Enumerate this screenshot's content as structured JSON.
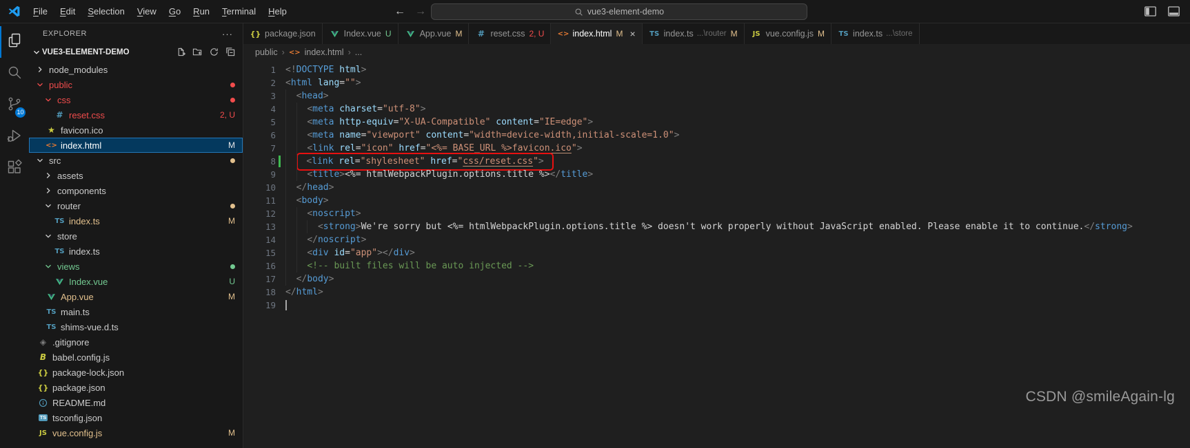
{
  "titlebar": {
    "menus": [
      "File",
      "Edit",
      "Selection",
      "View",
      "Go",
      "Run",
      "Terminal",
      "Help"
    ],
    "back_arrow": "←",
    "forward_arrow": "→",
    "search_value": "vue3-element-demo"
  },
  "activitybar": {
    "items": [
      {
        "name": "explorer",
        "active": true
      },
      {
        "name": "search",
        "active": false
      },
      {
        "name": "source-control",
        "active": false,
        "badge": "10"
      },
      {
        "name": "run-debug",
        "active": false
      },
      {
        "name": "extensions",
        "active": false
      }
    ]
  },
  "sidebar": {
    "header": "EXPLORER",
    "more_actions": "···",
    "project": "VUE3-ELEMENT-DEMO",
    "tree": [
      {
        "label": "node_modules",
        "level": 0,
        "chevron": "right",
        "status": "none"
      },
      {
        "label": "public",
        "level": 0,
        "chevron": "down",
        "status": "error",
        "badge": "dot",
        "badge_status": "error"
      },
      {
        "label": "css",
        "level": 1,
        "chevron": "down",
        "status": "error",
        "badge": "dot",
        "badge_status": "error"
      },
      {
        "label": "reset.css",
        "level": 2,
        "icon": "css",
        "status": "error",
        "badge": "2, U",
        "badge_status": "error"
      },
      {
        "label": "favicon.ico",
        "level": 1,
        "icon": "star",
        "status": "none"
      },
      {
        "label": "index.html",
        "level": 1,
        "icon": "html",
        "status": "selected",
        "selected": true,
        "badge": "M",
        "badge_status": "modified"
      },
      {
        "label": "src",
        "level": 0,
        "chevron": "down",
        "status": "none",
        "badge": "dot",
        "badge_status": "modified"
      },
      {
        "label": "assets",
        "level": 1,
        "chevron": "right",
        "status": "none"
      },
      {
        "label": "components",
        "level": 1,
        "chevron": "right",
        "status": "none"
      },
      {
        "label": "router",
        "level": 1,
        "chevron": "down",
        "status": "none",
        "badge": "dot",
        "badge_status": "modified"
      },
      {
        "label": "index.ts",
        "level": 2,
        "icon": "ts",
        "status": "modified",
        "badge": "M",
        "badge_status": "modified"
      },
      {
        "label": "store",
        "level": 1,
        "chevron": "down",
        "status": "none"
      },
      {
        "label": "index.ts",
        "level": 2,
        "icon": "ts",
        "status": "none"
      },
      {
        "label": "views",
        "level": 1,
        "chevron": "down",
        "status": "untracked",
        "badge": "dot",
        "badge_status": "untracked"
      },
      {
        "label": "Index.vue",
        "level": 2,
        "icon": "vue",
        "status": "untracked",
        "badge": "U",
        "badge_status": "untracked"
      },
      {
        "label": "App.vue",
        "level": 1,
        "icon": "vue",
        "status": "modified",
        "badge": "M",
        "badge_status": "modified"
      },
      {
        "label": "main.ts",
        "level": 1,
        "icon": "ts",
        "status": "none"
      },
      {
        "label": "shims-vue.d.ts",
        "level": 1,
        "icon": "ts",
        "status": "none"
      },
      {
        "label": ".gitignore",
        "level": 0,
        "icon": "git",
        "status": "none"
      },
      {
        "label": "babel.config.js",
        "level": 0,
        "icon": "babel",
        "status": "none"
      },
      {
        "label": "package-lock.json",
        "level": 0,
        "icon": "json",
        "status": "none"
      },
      {
        "label": "package.json",
        "level": 0,
        "icon": "json",
        "status": "none"
      },
      {
        "label": "README.md",
        "level": 0,
        "icon": "info",
        "status": "none"
      },
      {
        "label": "tsconfig.json",
        "level": 0,
        "icon": "tsconfig",
        "status": "none"
      },
      {
        "label": "vue.config.js",
        "level": 0,
        "icon": "js",
        "status": "modified",
        "badge": "M",
        "badge_status": "modified"
      }
    ]
  },
  "tabs": [
    {
      "icon": "json",
      "label": "package.json"
    },
    {
      "icon": "vue",
      "label": "Index.vue",
      "badge": "U",
      "badge_status": "untracked"
    },
    {
      "icon": "vue",
      "label": "App.vue",
      "badge": "M",
      "badge_status": "modified"
    },
    {
      "icon": "css",
      "label": "reset.css",
      "badge": "2, U",
      "badge_status": "error"
    },
    {
      "icon": "html",
      "label": "index.html",
      "badge": "M",
      "badge_status": "modified",
      "active": true,
      "close": "×"
    },
    {
      "icon": "ts",
      "label": "index.ts",
      "path_hint": "...\\router",
      "badge": "M",
      "badge_status": "modified"
    },
    {
      "icon": "js",
      "label": "vue.config.js",
      "badge": "M",
      "badge_status": "modified"
    },
    {
      "icon": "ts",
      "label": "index.ts",
      "path_hint": "...\\store"
    }
  ],
  "breadcrumb": {
    "folder": "public",
    "file": "index.html",
    "tail": "...",
    "separator": "›",
    "file_icon": "<>"
  },
  "editor": {
    "lines": [
      {
        "n": 1,
        "ind": 0,
        "tokens": [
          [
            "p",
            "<!"
          ],
          [
            "t",
            "DOCTYPE"
          ],
          [
            "x",
            " "
          ],
          [
            "a",
            "html"
          ],
          [
            "p",
            ">"
          ]
        ]
      },
      {
        "n": 2,
        "ind": 0,
        "tokens": [
          [
            "p",
            "<"
          ],
          [
            "t",
            "html"
          ],
          [
            "x",
            " "
          ],
          [
            "a",
            "lang"
          ],
          [
            "x",
            "="
          ],
          [
            "s",
            "\"\""
          ],
          [
            "p",
            ">"
          ]
        ]
      },
      {
        "n": 3,
        "ind": 1,
        "tokens": [
          [
            "x",
            "  "
          ],
          [
            "p",
            "<"
          ],
          [
            "t",
            "head"
          ],
          [
            "p",
            ">"
          ]
        ]
      },
      {
        "n": 4,
        "ind": 2,
        "tokens": [
          [
            "x",
            "    "
          ],
          [
            "p",
            "<"
          ],
          [
            "t",
            "meta"
          ],
          [
            "x",
            " "
          ],
          [
            "a",
            "charset"
          ],
          [
            "x",
            "="
          ],
          [
            "s",
            "\"utf-8\""
          ],
          [
            "p",
            ">"
          ]
        ]
      },
      {
        "n": 5,
        "ind": 2,
        "tokens": [
          [
            "x",
            "    "
          ],
          [
            "p",
            "<"
          ],
          [
            "t",
            "meta"
          ],
          [
            "x",
            " "
          ],
          [
            "a",
            "http-equiv"
          ],
          [
            "x",
            "="
          ],
          [
            "s",
            "\"X-UA-Compatible\""
          ],
          [
            "x",
            " "
          ],
          [
            "a",
            "content"
          ],
          [
            "x",
            "="
          ],
          [
            "s",
            "\"IE=edge\""
          ],
          [
            "p",
            ">"
          ]
        ]
      },
      {
        "n": 6,
        "ind": 2,
        "tokens": [
          [
            "x",
            "    "
          ],
          [
            "p",
            "<"
          ],
          [
            "t",
            "meta"
          ],
          [
            "x",
            " "
          ],
          [
            "a",
            "name"
          ],
          [
            "x",
            "="
          ],
          [
            "s",
            "\"viewport\""
          ],
          [
            "x",
            " "
          ],
          [
            "a",
            "content"
          ],
          [
            "x",
            "="
          ],
          [
            "s",
            "\"width=device-width,initial-scale=1.0\""
          ],
          [
            "p",
            ">"
          ]
        ]
      },
      {
        "n": 7,
        "ind": 2,
        "tokens": [
          [
            "x",
            "    "
          ],
          [
            "p",
            "<"
          ],
          [
            "t",
            "link"
          ],
          [
            "x",
            " "
          ],
          [
            "a",
            "rel"
          ],
          [
            "x",
            "="
          ],
          [
            "s",
            "\"icon\""
          ],
          [
            "x",
            " "
          ],
          [
            "a",
            "href"
          ],
          [
            "x",
            "="
          ],
          [
            "s",
            "\""
          ],
          [
            "su",
            "<%= BASE_URL %>favicon.ico"
          ],
          [
            "s",
            "\""
          ],
          [
            "p",
            ">"
          ]
        ]
      },
      {
        "n": 8,
        "ind": 2,
        "box": true,
        "mark": true,
        "tokens": [
          [
            "x",
            "    "
          ],
          [
            "p",
            "<"
          ],
          [
            "t",
            "link"
          ],
          [
            "x",
            " "
          ],
          [
            "a",
            "rel"
          ],
          [
            "x",
            "="
          ],
          [
            "s",
            "\"shylesheet\""
          ],
          [
            "x",
            " "
          ],
          [
            "a",
            "href"
          ],
          [
            "x",
            "="
          ],
          [
            "s",
            "\""
          ],
          [
            "su",
            "css/reset.css"
          ],
          [
            "s",
            "\""
          ],
          [
            "p",
            ">"
          ]
        ]
      },
      {
        "n": 9,
        "ind": 2,
        "tokens": [
          [
            "x",
            "    "
          ],
          [
            "p",
            "<"
          ],
          [
            "t",
            "title"
          ],
          [
            "p",
            ">"
          ],
          [
            "x",
            "<%= htmlWebpackPlugin.options.title %>"
          ],
          [
            "p",
            "</"
          ],
          [
            "t",
            "title"
          ],
          [
            "p",
            ">"
          ]
        ]
      },
      {
        "n": 10,
        "ind": 1,
        "tokens": [
          [
            "x",
            "  "
          ],
          [
            "p",
            "</"
          ],
          [
            "t",
            "head"
          ],
          [
            "p",
            ">"
          ]
        ]
      },
      {
        "n": 11,
        "ind": 1,
        "tokens": [
          [
            "x",
            "  "
          ],
          [
            "p",
            "<"
          ],
          [
            "t",
            "body"
          ],
          [
            "p",
            ">"
          ]
        ]
      },
      {
        "n": 12,
        "ind": 2,
        "tokens": [
          [
            "x",
            "    "
          ],
          [
            "p",
            "<"
          ],
          [
            "t",
            "noscript"
          ],
          [
            "p",
            ">"
          ]
        ]
      },
      {
        "n": 13,
        "ind": 3,
        "tokens": [
          [
            "x",
            "      "
          ],
          [
            "p",
            "<"
          ],
          [
            "t",
            "strong"
          ],
          [
            "p",
            ">"
          ],
          [
            "x",
            "We're sorry but <%= htmlWebpackPlugin.options.title %> doesn't work properly without JavaScript enabled. Please enable it to continue."
          ],
          [
            "p",
            "</"
          ],
          [
            "t",
            "strong"
          ],
          [
            "p",
            ">"
          ]
        ]
      },
      {
        "n": 14,
        "ind": 2,
        "tokens": [
          [
            "x",
            "    "
          ],
          [
            "p",
            "</"
          ],
          [
            "t",
            "noscript"
          ],
          [
            "p",
            ">"
          ]
        ]
      },
      {
        "n": 15,
        "ind": 2,
        "tokens": [
          [
            "x",
            "    "
          ],
          [
            "p",
            "<"
          ],
          [
            "t",
            "div"
          ],
          [
            "x",
            " "
          ],
          [
            "a",
            "id"
          ],
          [
            "x",
            "="
          ],
          [
            "s",
            "\"app\""
          ],
          [
            "p",
            ">"
          ],
          [
            "p",
            "</"
          ],
          [
            "t",
            "div"
          ],
          [
            "p",
            ">"
          ]
        ]
      },
      {
        "n": 16,
        "ind": 2,
        "tokens": [
          [
            "x",
            "    "
          ],
          [
            "c",
            "<!-- built files will be auto injected -->"
          ]
        ]
      },
      {
        "n": 17,
        "ind": 1,
        "tokens": [
          [
            "x",
            "  "
          ],
          [
            "p",
            "</"
          ],
          [
            "t",
            "body"
          ],
          [
            "p",
            ">"
          ]
        ]
      },
      {
        "n": 18,
        "ind": 0,
        "tokens": [
          [
            "p",
            "</"
          ],
          [
            "t",
            "html"
          ],
          [
            "p",
            ">"
          ]
        ]
      },
      {
        "n": 19,
        "ind": 0,
        "cursor": true,
        "tokens": []
      }
    ]
  },
  "watermark": "CSDN @smileAgain-lg",
  "colors": {
    "error": "#f14c4c",
    "modified": "#e2c08d",
    "untracked": "#73c991",
    "accent": "#0078d4",
    "selection_bg": "#04395e",
    "annotation_red": "#e81010",
    "added_gutter": "#3fb950"
  }
}
